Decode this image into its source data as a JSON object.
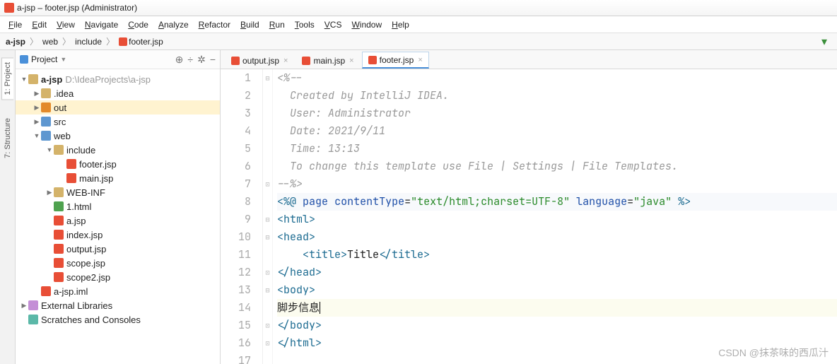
{
  "window": {
    "title": "a-jsp – footer.jsp (Administrator)"
  },
  "menu": [
    "File",
    "Edit",
    "View",
    "Navigate",
    "Code",
    "Analyze",
    "Refactor",
    "Build",
    "Run",
    "Tools",
    "VCS",
    "Window",
    "Help"
  ],
  "breadcrumb": [
    "a-jsp",
    "web",
    "include",
    "footer.jsp"
  ],
  "leftrail": [
    {
      "label": "1: Project",
      "active": true
    },
    {
      "label": "7: Structure",
      "active": false
    }
  ],
  "sidebar": {
    "title": "Project",
    "tools": [
      "⊕",
      "÷",
      "✲",
      "−"
    ],
    "tree": [
      {
        "depth": 0,
        "arr": "▼",
        "ico": "dir",
        "label": "a-jsp",
        "path": "D:\\IdeaProjects\\a-jsp",
        "sel": false,
        "bold": true
      },
      {
        "depth": 1,
        "arr": "▶",
        "ico": "dir",
        "label": ".idea"
      },
      {
        "depth": 1,
        "arr": "▶",
        "ico": "dir-o",
        "label": "out",
        "sel": true
      },
      {
        "depth": 1,
        "arr": "▶",
        "ico": "dir-b",
        "label": "src"
      },
      {
        "depth": 1,
        "arr": "▼",
        "ico": "dir-b",
        "label": "web"
      },
      {
        "depth": 2,
        "arr": "▼",
        "ico": "dir",
        "label": "include"
      },
      {
        "depth": 3,
        "arr": "",
        "ico": "jsp",
        "label": "footer.jsp"
      },
      {
        "depth": 3,
        "arr": "",
        "ico": "jsp",
        "label": "main.jsp"
      },
      {
        "depth": 2,
        "arr": "▶",
        "ico": "dir",
        "label": "WEB-INF"
      },
      {
        "depth": 2,
        "arr": "",
        "ico": "html",
        "label": "1.html"
      },
      {
        "depth": 2,
        "arr": "",
        "ico": "jsp",
        "label": "a.jsp"
      },
      {
        "depth": 2,
        "arr": "",
        "ico": "jsp",
        "label": "index.jsp"
      },
      {
        "depth": 2,
        "arr": "",
        "ico": "jsp",
        "label": "output.jsp"
      },
      {
        "depth": 2,
        "arr": "",
        "ico": "jsp",
        "label": "scope.jsp"
      },
      {
        "depth": 2,
        "arr": "",
        "ico": "jsp",
        "label": "scope2.jsp"
      },
      {
        "depth": 1,
        "arr": "",
        "ico": "jsp",
        "label": "a-jsp.iml"
      },
      {
        "depth": 0,
        "arr": "▶",
        "ico": "lib",
        "label": "External Libraries"
      },
      {
        "depth": 0,
        "arr": "",
        "ico": "scratch",
        "label": "Scratches and Consoles"
      }
    ]
  },
  "tabs": [
    {
      "label": "output.jsp",
      "active": false
    },
    {
      "label": "main.jsp",
      "active": false
    },
    {
      "label": "footer.jsp",
      "active": true
    }
  ],
  "code": {
    "lines": [
      {
        "n": 1,
        "html": "<span class='cmt'>&lt;%--</span>"
      },
      {
        "n": 2,
        "html": "<span class='cmt'>  Created by IntelliJ IDEA.</span>"
      },
      {
        "n": 3,
        "html": "<span class='cmt'>  User: Administrator</span>"
      },
      {
        "n": 4,
        "html": "<span class='cmt'>  Date: 2021/9/11</span>"
      },
      {
        "n": 5,
        "html": "<span class='cmt'>  Time: 13:13</span>"
      },
      {
        "n": 6,
        "html": "<span class='cmt'>  To change this template use File | Settings | File Templates.</span>"
      },
      {
        "n": 7,
        "html": "<span class='cmt'>--%&gt;</span>"
      },
      {
        "n": 8,
        "html": "<span class='tag'>&lt;%@</span> <span class='kw'>page</span> <span class='kw'>contentType</span>=<span class='str'>\"text/html;charset=UTF-8\"</span> <span class='kw'>language</span>=<span class='str'>\"java\"</span> <span class='tag'>%&gt;</span>",
        "dir": true
      },
      {
        "n": 9,
        "html": "<span class='tag'>&lt;html&gt;</span>"
      },
      {
        "n": 10,
        "html": "<span class='tag'>&lt;head&gt;</span>"
      },
      {
        "n": 11,
        "html": "    <span class='tag'>&lt;title&gt;</span><span class='txt'>Title</span><span class='tag'>&lt;/title&gt;</span>"
      },
      {
        "n": 12,
        "html": "<span class='tag'>&lt;/head&gt;</span>"
      },
      {
        "n": 13,
        "html": "<span class='tag'>&lt;body&gt;</span>"
      },
      {
        "n": 14,
        "html": "<span class='txt'>脚步信息</span><span class='cursor'></span>",
        "hl": true
      },
      {
        "n": 15,
        "html": "<span class='tag'>&lt;/body&gt;</span>"
      },
      {
        "n": 16,
        "html": "<span class='tag'>&lt;/html&gt;</span>"
      },
      {
        "n": 17,
        "html": ""
      }
    ]
  },
  "watermark": "CSDN @抹茶味的西瓜汁"
}
